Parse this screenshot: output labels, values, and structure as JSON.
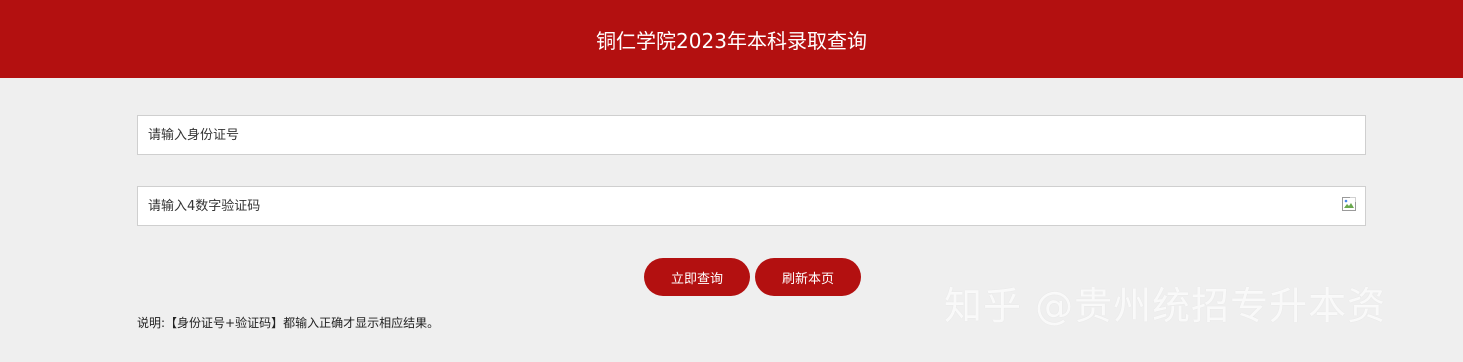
{
  "header": {
    "title": "铜仁学院2023年本科录取查询"
  },
  "form": {
    "id_placeholder": "请输入身份证号",
    "captcha_placeholder": "请输入4数字验证码",
    "captcha_image_icon": "broken-image-icon"
  },
  "buttons": {
    "query_label": "立即查询",
    "refresh_label": "刷新本页"
  },
  "note": {
    "text": "说明:【身份证号+验证码】都输入正确才显示相应结果。"
  },
  "watermark": {
    "text": "知乎 @贵州统招专升本资"
  },
  "colors": {
    "accent": "#b31010",
    "background": "#efefef"
  }
}
